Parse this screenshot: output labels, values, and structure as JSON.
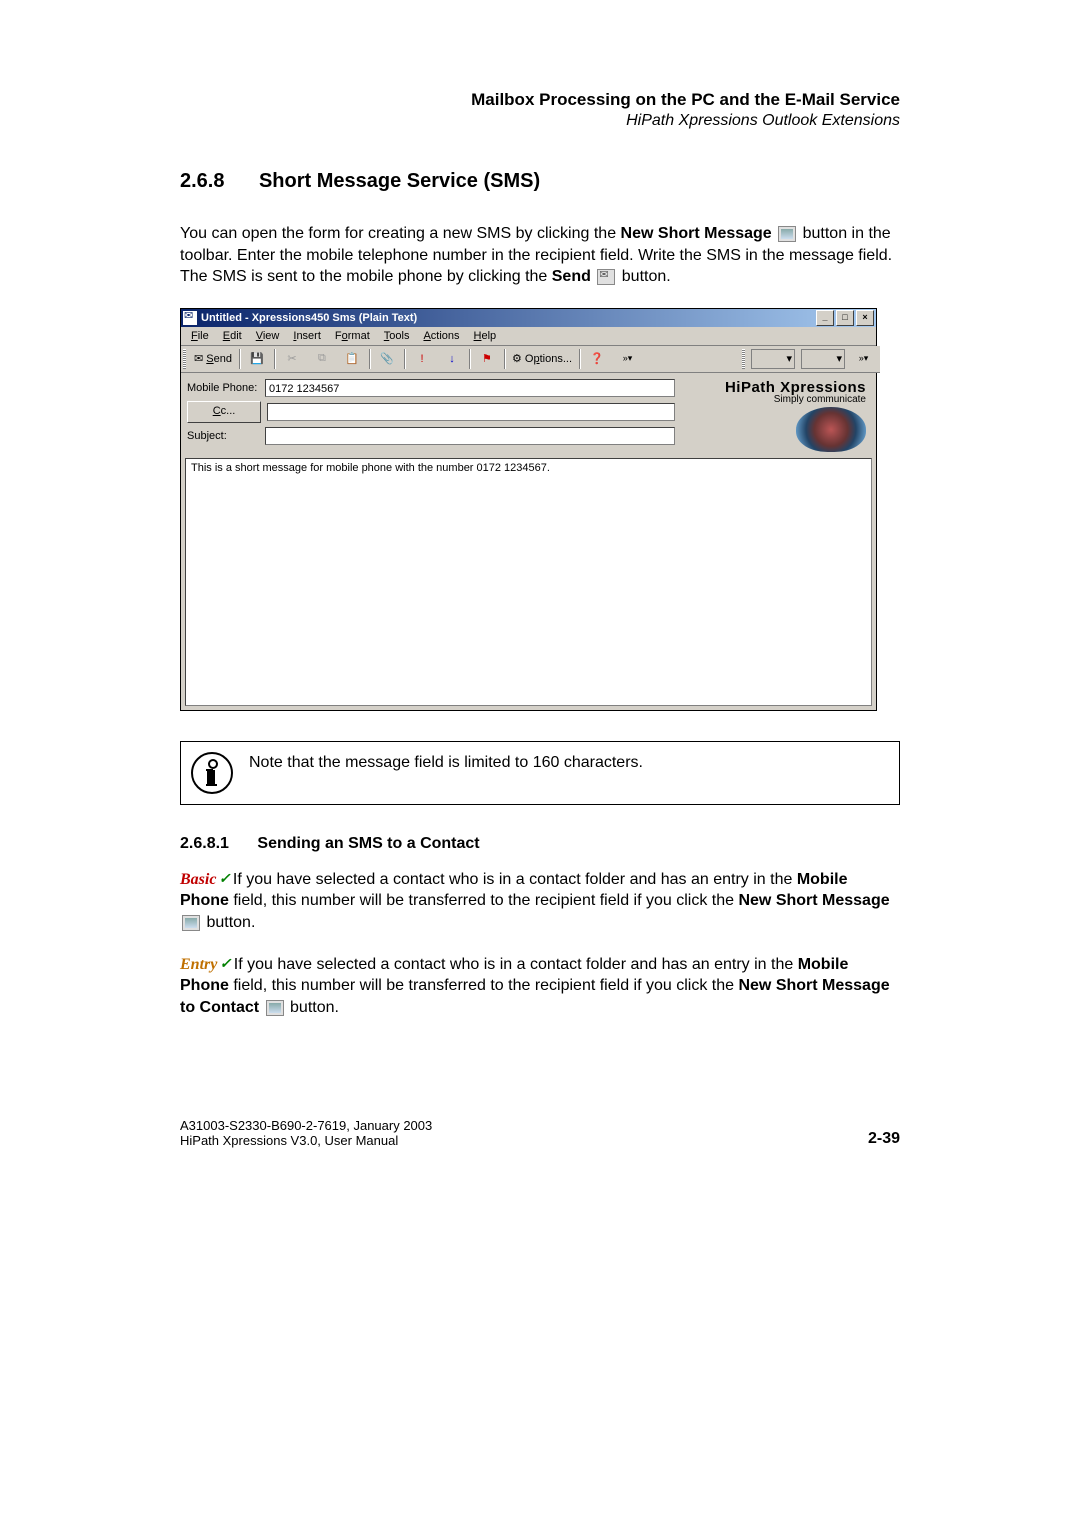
{
  "header": {
    "title": "Mailbox Processing on the PC and the E-Mail Service",
    "subtitle": "HiPath Xpressions Outlook Extensions"
  },
  "section": {
    "number": "2.6.8",
    "title": "Short Message Service (SMS)"
  },
  "intro": {
    "p1a": "You can open the form for creating a new SMS by clicking the ",
    "p1b": "New Short Message",
    "p1c": " button in the toolbar. Enter the mobile telephone number in the recipient field. Write the SMS in the message field. The SMS is sent to the mobile phone by clicking the ",
    "p1d": "Send",
    "p1e": " button."
  },
  "window": {
    "title": "Untitled - Xpressions450 Sms (Plain Text)",
    "controls": {
      "min": "_",
      "max": "□",
      "close": "×"
    },
    "menu": {
      "file": "File",
      "edit": "Edit",
      "view": "View",
      "insert": "Insert",
      "format": "Format",
      "tools": "Tools",
      "actions": "Actions",
      "help": "Help"
    },
    "toolbar": {
      "send": "Send",
      "options": "Options..."
    },
    "fields": {
      "mobile_label": "Mobile Phone:",
      "mobile_value": "0172 1234567",
      "cc_label": "Cc...",
      "subject_label": "Subject:"
    },
    "logo": {
      "title": "HiPath Xpressions",
      "sub": "Simply communicate"
    },
    "body": "This is a short message for mobile phone with the number 0172 1234567."
  },
  "note": "Note that the message field is limited to 160 characters.",
  "subsection": {
    "number": "2.6.8.1",
    "title": "Sending an SMS to a Contact"
  },
  "basic": {
    "label": "Basic",
    "t1": " If you have selected a contact who is in a contact folder and has an entry in the ",
    "b1": "Mobile Phone",
    "t2": " field, this number will be transferred to the recipient field if you click the ",
    "b2": "New Short Message",
    "t3": " button."
  },
  "entry": {
    "label": "Entry",
    "t1": " If you have selected a contact who is in a contact folder and has an entry in the ",
    "b1": "Mobile Phone",
    "t2": " field, this number will be transferred to the recipient field if you click the ",
    "b2": "New Short Message to Contact",
    "t3": " button."
  },
  "footer": {
    "line1": "A31003-S2330-B690-2-7619, January 2003",
    "line2": "HiPath Xpressions V3.0, User Manual",
    "page": "2-39"
  }
}
